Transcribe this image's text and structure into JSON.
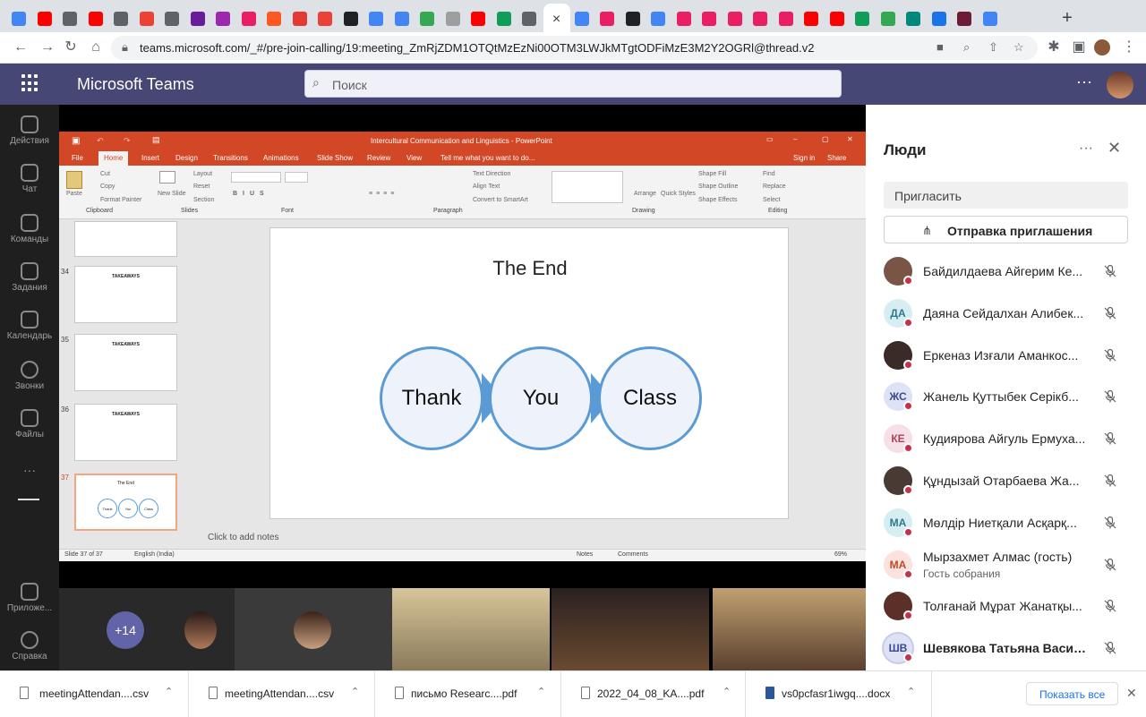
{
  "browser": {
    "url": "teams.microsoft.com/_#/pre-join-calling/19:meeting_ZmRjZDM1OTQtMzEzNi00OTM3LWJkMTgtODFiMzE3M2Y2OGRl@thread.v2",
    "tab_close": "×",
    "new_tab": "+",
    "favicons": [
      "#4285f4",
      "#ff0000",
      "#5f6368",
      "#ff0000",
      "#5f6368",
      "#ea4335",
      "#5f6368",
      "#6a1b9a",
      "#9c27b0",
      "#e91e63",
      "#ff5722",
      "#e53935",
      "#ea4335",
      "#202124",
      "#4285f4",
      "#4285f4",
      "#34a853",
      "#9e9e9e",
      "#ff0000",
      "#0f9d58",
      "#5f6368",
      "#5f6368",
      "#4285f4",
      "#e91e63",
      "#202124",
      "#4285f4",
      "#e91e63",
      "#e91e63",
      "#e91e63",
      "#e91e63",
      "#e91e63",
      "#ff0000",
      "#ff0000",
      "#0f9d58",
      "#34a853",
      "#00897b",
      "#1a73e8",
      "#6d1b36",
      "#4285f4"
    ]
  },
  "teams": {
    "title": "Microsoft Teams",
    "search_placeholder": "Поиск",
    "more": "···"
  },
  "rail": [
    {
      "label": "Действия"
    },
    {
      "label": "Чат"
    },
    {
      "label": "Команды"
    },
    {
      "label": "Задания"
    },
    {
      "label": "Календарь"
    },
    {
      "label": "Звонки"
    },
    {
      "label": "Файлы"
    },
    {
      "label": "···"
    },
    {
      "label": "Приложе..."
    },
    {
      "label": "Справка"
    }
  ],
  "ppt": {
    "title": "Intercultural Communication and Linguistics - PowerPoint",
    "tabs": [
      "File",
      "Home",
      "Insert",
      "Design",
      "Transitions",
      "Animations",
      "Slide Show",
      "Review",
      "View"
    ],
    "tell_me": "Tell me what you want to do...",
    "sign_in": "Sign in",
    "share": "Share",
    "groups": [
      "Clipboard",
      "Slides",
      "Font",
      "Paragraph",
      "Drawing",
      "Editing"
    ],
    "ribbon": {
      "paste": "Paste",
      "cut": "Cut",
      "copy": "Copy",
      "format_painter": "Format Painter",
      "new_slide": "New Slide",
      "layout": "Layout",
      "reset": "Reset",
      "section": "Section",
      "text_direction": "Text Direction",
      "align_text": "Align Text",
      "convert": "Convert to SmartArt",
      "arrange": "Arrange",
      "quick_styles": "Quick Styles",
      "shape_fill": "Shape Fill",
      "shape_outline": "Shape Outline",
      "shape_effects": "Shape Effects",
      "find": "Find",
      "replace": "Replace",
      "select": "Select"
    },
    "thumbs": [
      {
        "num": "34",
        "title": "TAKEAWAYS"
      },
      {
        "num": "35",
        "title": "TAKEAWAYS"
      },
      {
        "num": "36",
        "title": "TAKEAWAYS"
      },
      {
        "num": "37",
        "title": "The End"
      }
    ],
    "slide": {
      "title": "The End",
      "words": [
        "Thank",
        "You",
        "Class"
      ]
    },
    "notes_placeholder": "Click to add notes",
    "status": {
      "slide_of": "Slide 37 of 37",
      "language": "English (India)",
      "notes": "Notes",
      "comments": "Comments",
      "zoom": "69%"
    }
  },
  "videos": {
    "overflow": "+14"
  },
  "people": {
    "title": "Люди",
    "invite_placeholder": "Пригласить",
    "send_invite": "Отправка приглашения",
    "list": [
      {
        "name": "Байдилдаева Айгерим Ке...",
        "initials": "",
        "bg": "#7a5545",
        "fg": "#fff",
        "sub": ""
      },
      {
        "name": "Даяна Сейдалхан Алибек...",
        "initials": "ДА",
        "bg": "#d6eef2",
        "fg": "#2f7a8c",
        "sub": ""
      },
      {
        "name": "Еркеназ Изғали Аманкос...",
        "initials": "",
        "bg": "#3a2a28",
        "fg": "#fff",
        "sub": ""
      },
      {
        "name": "Жанель Қуттыбек Серікб...",
        "initials": "ЖС",
        "bg": "#dde2f4",
        "fg": "#3c4a8c",
        "sub": ""
      },
      {
        "name": "Кудиярова Айгуль Ермуха...",
        "initials": "КЕ",
        "bg": "#f6dfe6",
        "fg": "#b0405a",
        "sub": ""
      },
      {
        "name": "Құндызай Отарбаева Жа...",
        "initials": "",
        "bg": "#4a3a34",
        "fg": "#fff",
        "sub": ""
      },
      {
        "name": "Мөлдір Ниетқали Асқарқ...",
        "initials": "МА",
        "bg": "#d6eef2",
        "fg": "#2f7a8c",
        "sub": ""
      },
      {
        "name": "Мырзахмет Алмас (гость)",
        "initials": "МА",
        "bg": "#fbe2dc",
        "fg": "#c04a2a",
        "sub": "Гость собрания"
      },
      {
        "name": "Толғанай Мұрат Жанатқы...",
        "initials": "",
        "bg": "#5a3028",
        "fg": "#fff",
        "sub": ""
      },
      {
        "name": "Шевякова Татьяна Васильев...",
        "initials": "ШВ",
        "bg": "#dde2f4",
        "fg": "#3c4a8c",
        "sub": ""
      }
    ]
  },
  "downloads": {
    "items": [
      {
        "name": "meetingAttendan....csv"
      },
      {
        "name": "meetingAttendan....csv"
      },
      {
        "name": "письмо Researc....pdf"
      },
      {
        "name": "2022_04_08_KA....pdf"
      },
      {
        "name": "vs0pcfasr1iwgq....docx"
      }
    ],
    "show_all": "Показать все"
  }
}
